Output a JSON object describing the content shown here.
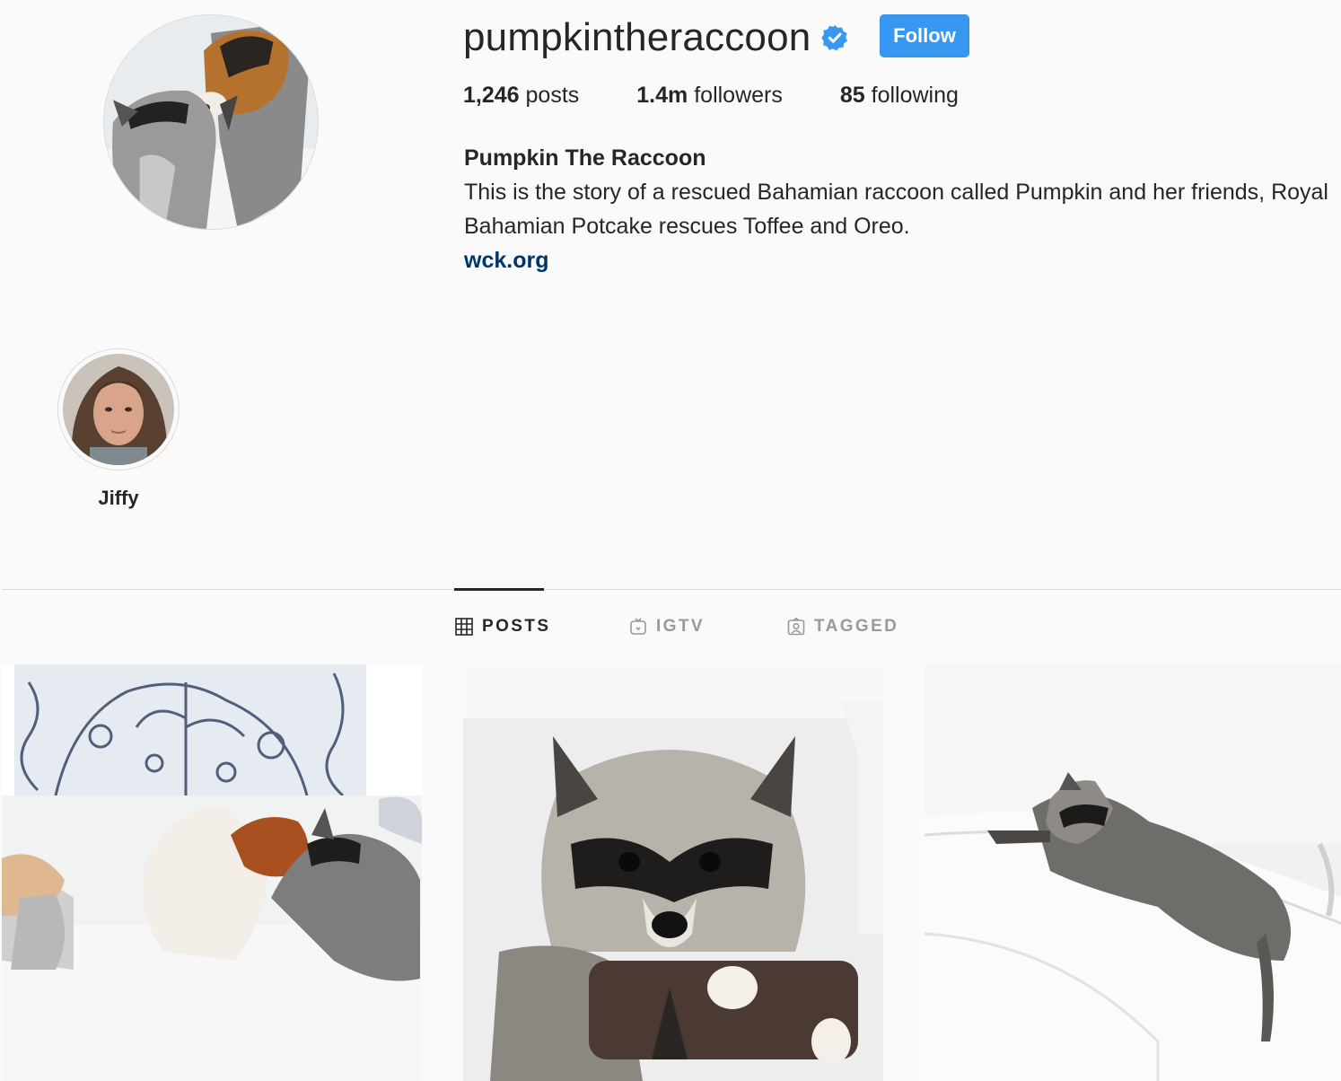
{
  "profile": {
    "username": "pumpkintheraccoon",
    "verified": true,
    "follow_label": "Follow",
    "stats": [
      {
        "count": "1,246",
        "label": "posts"
      },
      {
        "count": "1.4m",
        "label": "followers"
      },
      {
        "count": "85",
        "label": "following"
      }
    ],
    "full_name": "Pumpkin The Raccoon",
    "bio": "This is the story of a rescued Bahamian raccoon called Pumpkin and her friends, Royal Bahamian Potcake rescues Toffee and Oreo.",
    "link": "wck.org"
  },
  "highlights": [
    {
      "label": "Jiffy"
    }
  ],
  "tabs": [
    {
      "label": "POSTS",
      "icon": "grid-icon",
      "active": true
    },
    {
      "label": "IGTV",
      "icon": "igtv-icon",
      "active": false
    },
    {
      "label": "TAGGED",
      "icon": "tagged-icon",
      "active": false
    }
  ],
  "posts": [
    {
      "subject": "dogs-and-raccoon-on-sofa"
    },
    {
      "subject": "raccoon-closeup"
    },
    {
      "subject": "raccoon-lying-on-furniture"
    }
  ],
  "colors": {
    "accent": "#3897f0",
    "verified": "#3897f0",
    "link": "#003569",
    "text": "#262626",
    "muted": "#999999",
    "background": "#fafafa",
    "border": "#dbdbdb"
  }
}
